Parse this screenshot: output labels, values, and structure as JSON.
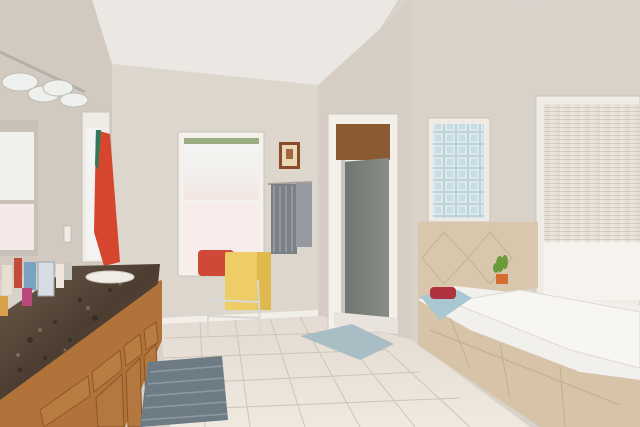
{
  "scene": {
    "colors": {
      "ceiling": "#e9e6e1",
      "wall_left": "#d3cbc3",
      "wall_back": "#dcd5cc",
      "wall_right": "#d8d1c8",
      "floor": "#e8e0d6",
      "granite": "#5b4a3c",
      "cabinet": "#b27538",
      "tile_tub": "#d9c7ae",
      "towel_red": "#d44a35",
      "towel_yellow": "#efcf6a",
      "rug": "#6f7c86"
    }
  }
}
